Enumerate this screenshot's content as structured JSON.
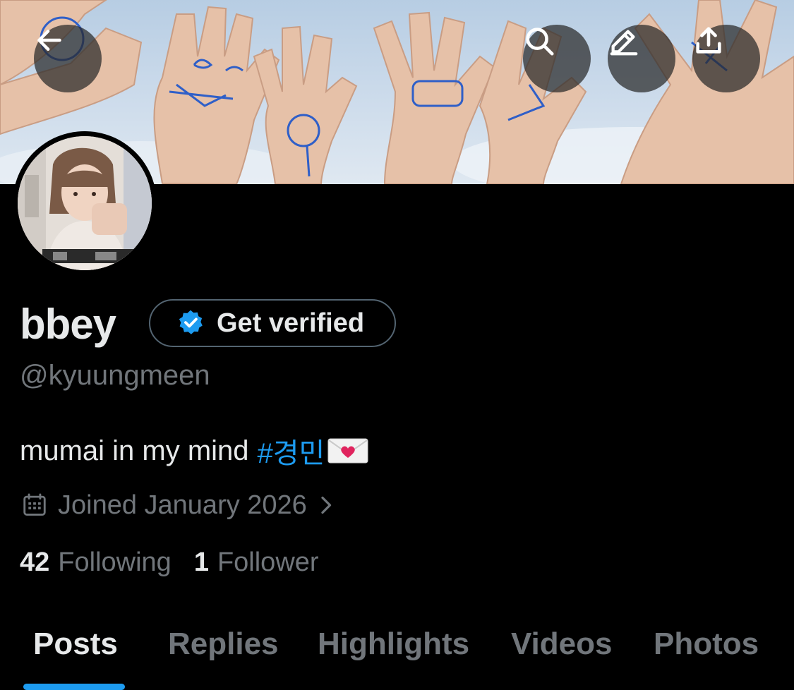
{
  "header": {
    "back_icon": "arrow-left-icon",
    "search_icon": "search-icon",
    "edit_icon": "edit-icon",
    "share_icon": "share-icon"
  },
  "profile": {
    "display_name": "bbey",
    "verify_button_label": "Get verified",
    "handle": "@kyuungmeen",
    "bio_text": "mumai in my mind",
    "bio_hashtag": "#경민",
    "joined": "Joined January 2026",
    "following_count": "42",
    "following_label": "Following",
    "followers_count": "1",
    "followers_label": "Follower"
  },
  "tabs": [
    {
      "label": "Posts",
      "active": true
    },
    {
      "label": "Replies",
      "active": false
    },
    {
      "label": "Highlights",
      "active": false
    },
    {
      "label": "Videos",
      "active": false
    },
    {
      "label": "Photos",
      "active": false
    }
  ],
  "colors": {
    "background": "#000000",
    "accent": "#1d9bf0",
    "text_primary": "#e7e9ea",
    "text_secondary": "#71767b"
  }
}
